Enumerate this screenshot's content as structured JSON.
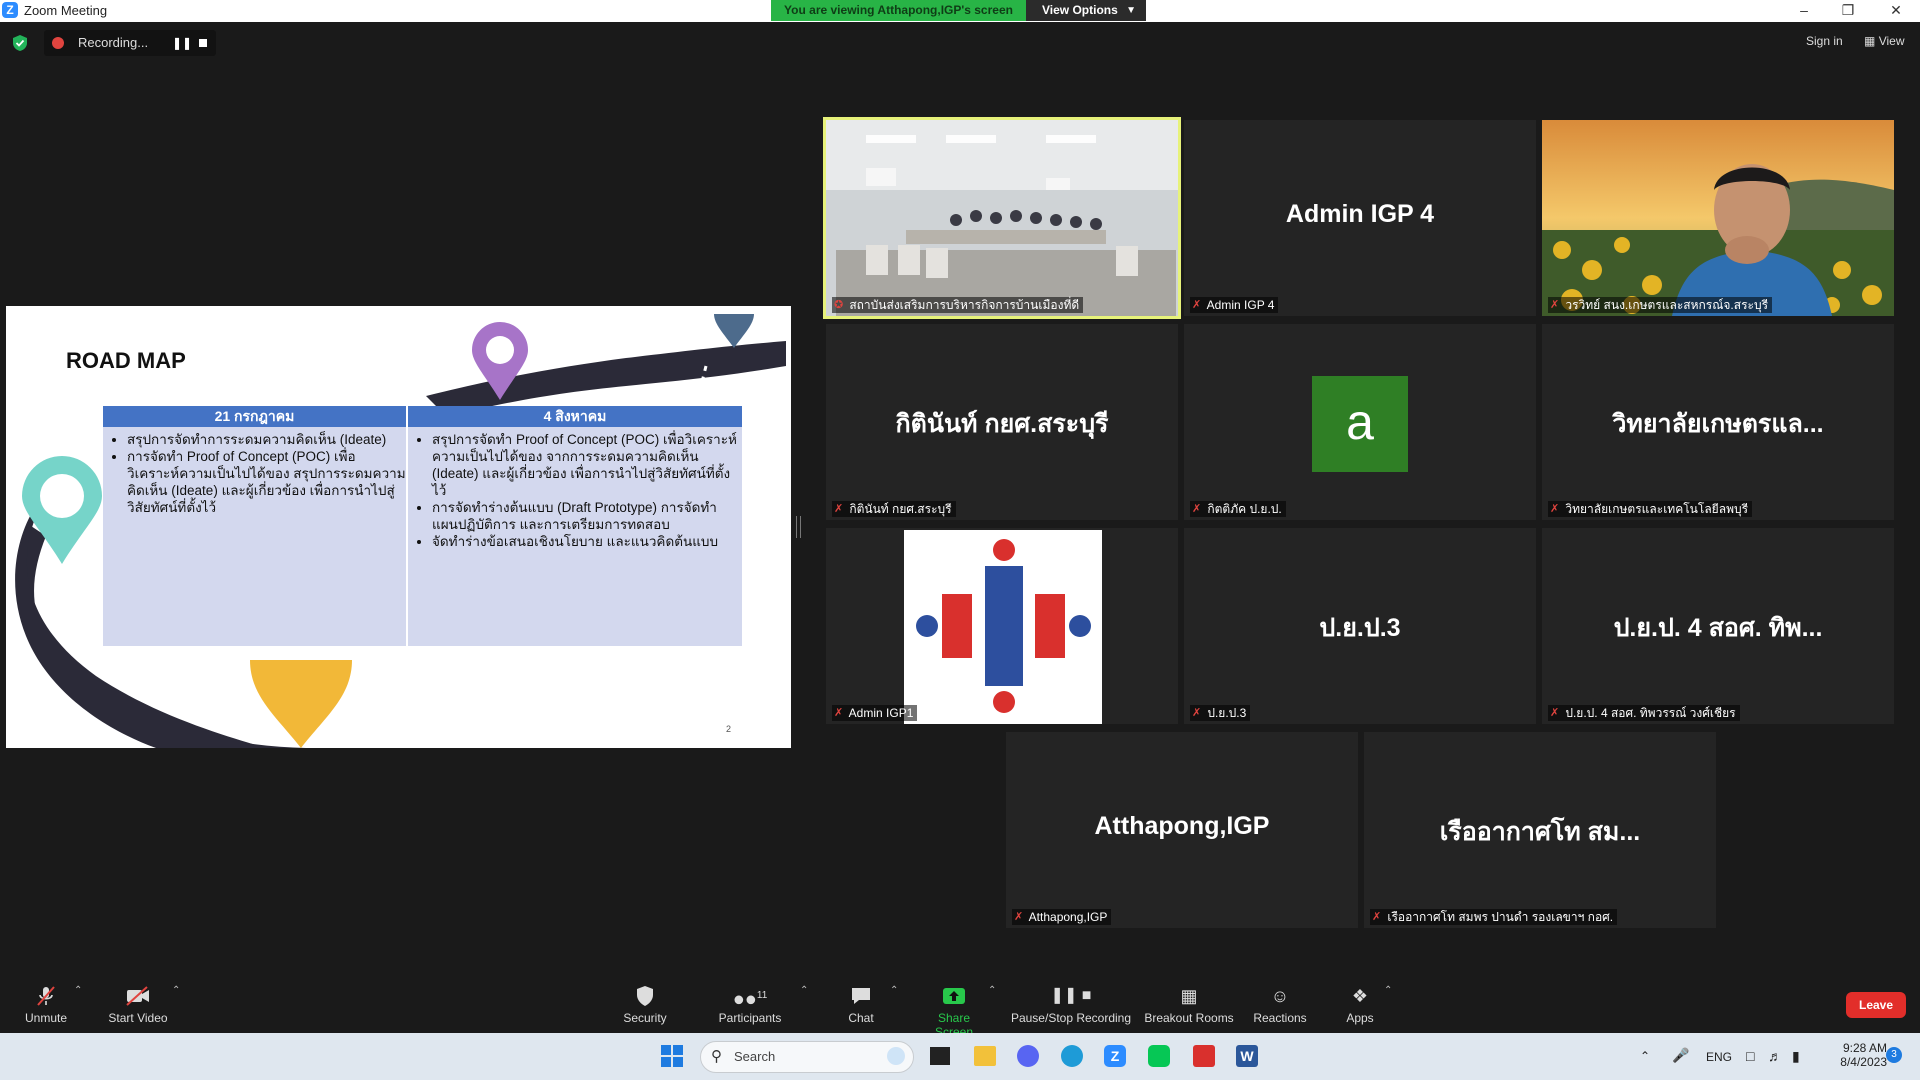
{
  "titlebar": {
    "app_title": "Zoom Meeting",
    "share_banner": "You are viewing Atthapong,IGP's screen",
    "view_options": "View Options"
  },
  "meeting_top": {
    "recording_label": "Recording...",
    "sign_in": "Sign in",
    "view": "View"
  },
  "slide": {
    "title": "ROAD MAP",
    "columns": [
      {
        "header": "21 กรกฎาคม",
        "items": [
          "สรุปการจัดทำการระดมความคิดเห็น (Ideate)",
          "การจัดทำ Proof of Concept (POC) เพื่อวิเคราะห์ความเป็นไปได้ของ สรุปการระดมความคิดเห็น (Ideate) และผู้เกี่ยวข้อง เพื่อการนำไปสู่วิสัยทัศน์ที่ตั้งไว้"
        ]
      },
      {
        "header": "4 สิงหาคม",
        "items": [
          "สรุปการจัดทำ Proof of Concept (POC) เพื่อวิเคราะห์ความเป็นไปได้ของ จากการระดมความคิดเห็น (Ideate) และผู้เกี่ยวข้อง เพื่อการนำไปสู่วิสัยทัศน์ที่ตั้งไว้",
          "การจัดทำร่างต้นแบบ (Draft Prototype) การจัดทำแผนปฏิบัติการ และการเตรียมการทดสอบ",
          "จัดทำร่างข้อเสนอเชิงนโยบาย และแนวคิดต้นแบบ"
        ]
      }
    ],
    "page_number": "2"
  },
  "tiles": [
    {
      "label": "สถาบันส่งเสริมการบริหารกิจการบ้านเมืองที่ดี",
      "big": ""
    },
    {
      "label": "Admin IGP 4",
      "big": "Admin IGP 4"
    },
    {
      "label": "วรวิทย์ สนง.เกษตรและสหกรณ์จ.สระบุรี",
      "big": ""
    },
    {
      "label": "กิตินันท์ กยศ.สระบุรี",
      "big": "กิตินันท์ กยศ.สระบุรี"
    },
    {
      "label": "กิตติภัค ป.ย.ป.",
      "big": "",
      "avatar_letter": "a"
    },
    {
      "label": "วิทยาลัยเกษตรและเทคโนโลยีลพบุรี",
      "big": "วิทยาลัยเกษตรแล..."
    },
    {
      "label": "Admin IGP1",
      "big": ""
    },
    {
      "label": "ป.ย.ป.3",
      "big": "ป.ย.ป.3"
    },
    {
      "label": "ป.ย.ป. 4 สอศ. ทิพวรรณ์ วงศ์เชียร",
      "big": "ป.ย.ป. 4 สอศ. ทิพ..."
    },
    {
      "label": "Atthapong,IGP",
      "big": "Atthapong,IGP"
    },
    {
      "label": "เรืออากาศโท สมพร ปานดำ รองเลขาฯ กอศ.",
      "big": "เรืออากาศโท สม..."
    }
  ],
  "toolbar": {
    "unmute": "Unmute",
    "start_video": "Start Video",
    "security": "Security",
    "participants": "Participants",
    "participants_count": "11",
    "chat": "Chat",
    "share_screen": "Share Screen",
    "pause_recording": "Pause/Stop Recording",
    "breakout": "Breakout Rooms",
    "reactions": "Reactions",
    "apps": "Apps",
    "leave": "Leave"
  },
  "taskbar": {
    "search_placeholder": "Search",
    "language": "ENG",
    "time": "9:28 AM",
    "date": "8/4/2023",
    "notification_count": "3"
  },
  "colors": {
    "zoom_blue": "#2D8CFF",
    "share_green": "#28b446",
    "leave_red": "#e22e2a",
    "active_speaker": "#e7f27a"
  }
}
